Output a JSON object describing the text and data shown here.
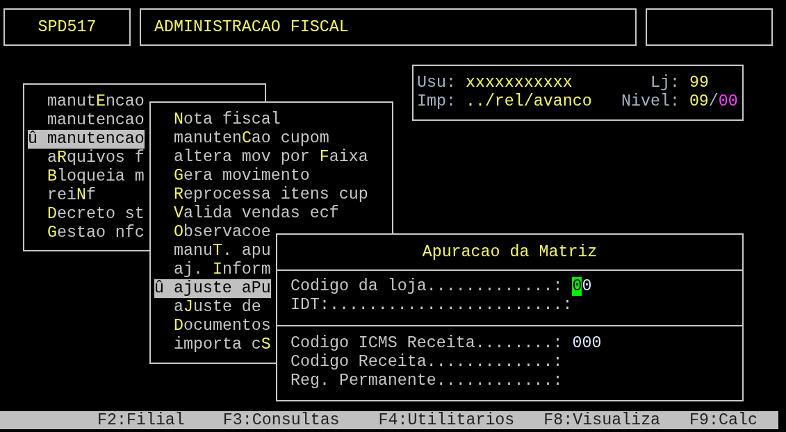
{
  "header": {
    "program_code": "SPD517",
    "title": "ADMINISTRACAO FISCAL"
  },
  "info": {
    "user_label": "Usu:",
    "user": "xxxxxxxxxxx",
    "store_label": "Lj:",
    "store": "99",
    "printer_label": "Imp:",
    "printer": "../rel/avanco",
    "nivel_label": "Nivel:",
    "nivel_value": "09",
    "nivel_separator": "/",
    "nivel_sub": "00"
  },
  "main_menu": [
    {
      "before": "manut",
      "key": "E",
      "after": "ncao",
      "selected": false
    },
    {
      "before": "manutencao",
      "selected": false
    },
    {
      "marker": "û",
      "before": "manutencao",
      "selected": true
    },
    {
      "before": "a",
      "key": "R",
      "after": "quivos f",
      "selected": false
    },
    {
      "key": "B",
      "after": "loqueia m",
      "selected": false
    },
    {
      "before": "rei",
      "key": "N",
      "after": "f",
      "selected": false
    },
    {
      "key": "D",
      "after": "ecreto st",
      "selected": false
    },
    {
      "key": "G",
      "after": "estao nfc",
      "selected": false
    }
  ],
  "submenu": [
    {
      "key": "N",
      "after": "ota fiscal",
      "selected": false
    },
    {
      "before": "manuten",
      "key": "C",
      "after": "ao cupom",
      "selected": false
    },
    {
      "before": "altera mov por ",
      "key": "F",
      "after": "aixa",
      "selected": false
    },
    {
      "key": "G",
      "after": "era movimento",
      "selected": false
    },
    {
      "key": "R",
      "after": "eprocessa itens cup",
      "selected": false
    },
    {
      "key": "V",
      "after": "alida vendas ecf",
      "selected": false
    },
    {
      "key": "O",
      "after": "bservacoe",
      "selected": false
    },
    {
      "before": "manu",
      "key": "T",
      "after": ". apu",
      "selected": false
    },
    {
      "before": "aj. ",
      "key": "I",
      "after": "nform",
      "selected": false
    },
    {
      "marker": "û",
      "before": "ajuste a",
      "key": "P",
      "after": "u",
      "selected": true
    },
    {
      "before": "a",
      "key": "J",
      "after": "uste de",
      "selected": false
    },
    {
      "key": "D",
      "after": "ocumentos",
      "selected": false
    },
    {
      "before": "importa c",
      "key": "S",
      "selected": false
    }
  ],
  "dialog": {
    "title": "Apuracao da Matriz",
    "sections": [
      [
        {
          "label": "Codigo da loja.............:",
          "value": "00",
          "cursor": true
        },
        {
          "label": "IDT:........................:"
        }
      ],
      [
        {
          "label": "Codigo ICMS Receita........:",
          "value": "000",
          "cursor": false
        },
        {
          "label": "Codigo Receita.............:"
        },
        {
          "label": "Reg. Permanente............:"
        }
      ]
    ]
  },
  "function_keys": [
    "F2:Filial",
    "F3:Consultas",
    "F4:Utilitarios",
    "F8:Visualiza",
    "F9:Calc"
  ]
}
